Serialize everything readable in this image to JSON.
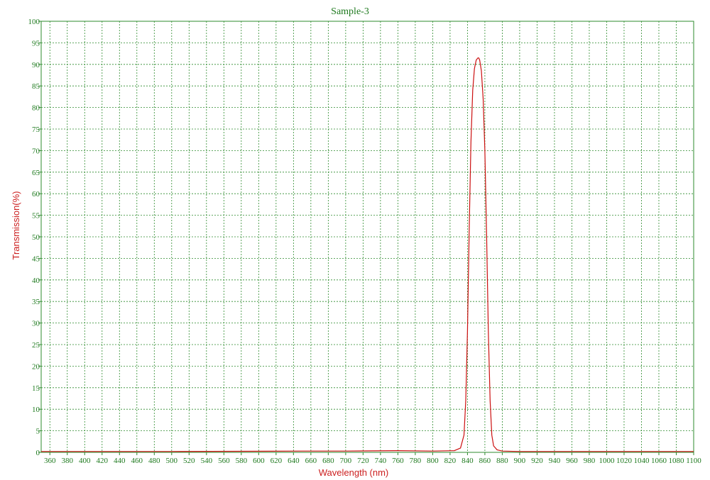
{
  "chart_data": {
    "type": "line",
    "title": "Sample-3",
    "xlabel": "Wavelength (nm)",
    "ylabel": "Transmission(%)",
    "xlim": [
      350,
      1100
    ],
    "ylim": [
      0,
      100
    ],
    "grid": true,
    "x_ticks": [
      360,
      380,
      400,
      420,
      440,
      460,
      480,
      500,
      520,
      540,
      560,
      580,
      600,
      620,
      640,
      660,
      680,
      700,
      720,
      740,
      760,
      780,
      800,
      820,
      840,
      860,
      880,
      900,
      920,
      940,
      960,
      980,
      1000,
      1020,
      1040,
      1060,
      1080,
      1100
    ],
    "y_ticks": [
      0,
      5,
      10,
      15,
      20,
      25,
      30,
      35,
      40,
      45,
      50,
      55,
      60,
      65,
      70,
      75,
      80,
      85,
      90,
      95,
      100
    ],
    "colors": {
      "curve": "#cc1010",
      "grid": "#2e8b2e",
      "title": "#1f7a1f",
      "axis_label": "#cc2020"
    },
    "series": [
      {
        "x": [
          350,
          500,
          650,
          700,
          760,
          800,
          825,
          832,
          836,
          838,
          840,
          842,
          844,
          846,
          848,
          850,
          852,
          853,
          854,
          856,
          858,
          860,
          862,
          864,
          866,
          868,
          870,
          874,
          880,
          900,
          1000,
          1100
        ],
        "y": [
          0.2,
          0.2,
          0.3,
          0.3,
          0.4,
          0.3,
          0.4,
          1.0,
          4.0,
          12.0,
          28.0,
          52.0,
          72.0,
          84.0,
          89.0,
          91.0,
          91.5,
          91.5,
          91.0,
          88.5,
          82.0,
          70.0,
          50.0,
          28.0,
          12.0,
          4.0,
          1.5,
          0.6,
          0.3,
          0.2,
          0.2,
          0.2
        ]
      }
    ]
  }
}
